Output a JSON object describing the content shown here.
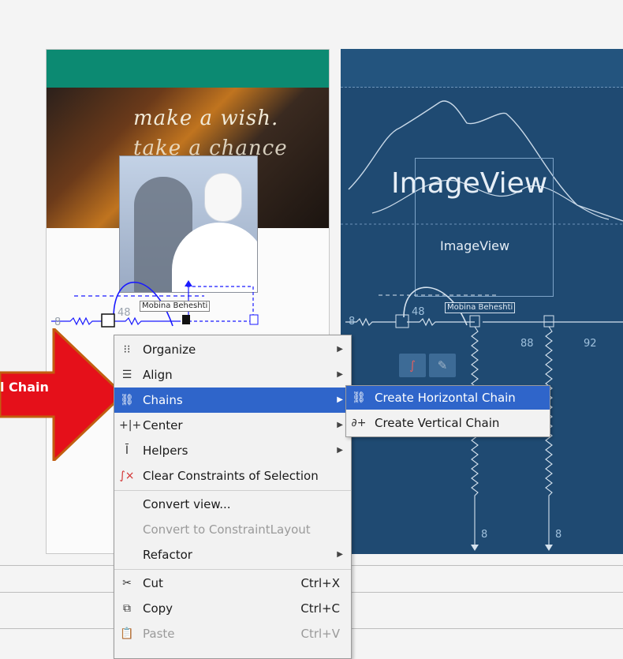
{
  "design": {
    "hero_line1": "make a wish.",
    "hero_line2": "take a chance",
    "name_label": "Mobina Beheshti",
    "margin_left": "8",
    "margin_top": "48"
  },
  "blueprint": {
    "image_big": "ImageView",
    "image_small": "ImageView",
    "name_label": "Mobina Beheshti",
    "margin_left": "8",
    "margin_top": "48",
    "margin_a": "88",
    "margin_b": "92",
    "margin_bottom_1": "8",
    "margin_bottom_2": "8"
  },
  "callout": {
    "text": "l Chain",
    "color": "#e5101a"
  },
  "context_menu": {
    "items": [
      {
        "icon": "organize-icon",
        "label": "Organize",
        "submenu": true
      },
      {
        "icon": "align-icon",
        "label": "Align",
        "submenu": true
      },
      {
        "icon": "chains-icon",
        "label": "Chains",
        "submenu": true,
        "selected": true
      },
      {
        "icon": "center-icon",
        "label": "Center",
        "submenu": true
      },
      {
        "icon": "helpers-icon",
        "label": "Helpers",
        "submenu": true
      },
      {
        "icon": "clear-constraints-icon",
        "label": "Clear Constraints of Selection"
      },
      {
        "label": "Convert view..."
      },
      {
        "label": "Convert to ConstraintLayout",
        "disabled": true
      },
      {
        "label": "Refactor",
        "submenu": true
      },
      {
        "icon": "cut-icon",
        "label": "Cut",
        "shortcut": "Ctrl+X"
      },
      {
        "icon": "copy-icon",
        "label": "Copy",
        "shortcut": "Ctrl+C"
      },
      {
        "icon": "paste-icon",
        "label": "Paste",
        "shortcut": "Ctrl+V",
        "disabled": true
      }
    ]
  },
  "chains_submenu": {
    "items": [
      {
        "icon": "horizontal-chain-icon",
        "label": "Create Horizontal Chain",
        "selected": true
      },
      {
        "icon": "vertical-chain-icon",
        "label": "Create Vertical Chain"
      }
    ]
  },
  "colors": {
    "selection": "#2f65ca",
    "appbar": "#0c8a72",
    "blueprint": "#1f4a72"
  }
}
